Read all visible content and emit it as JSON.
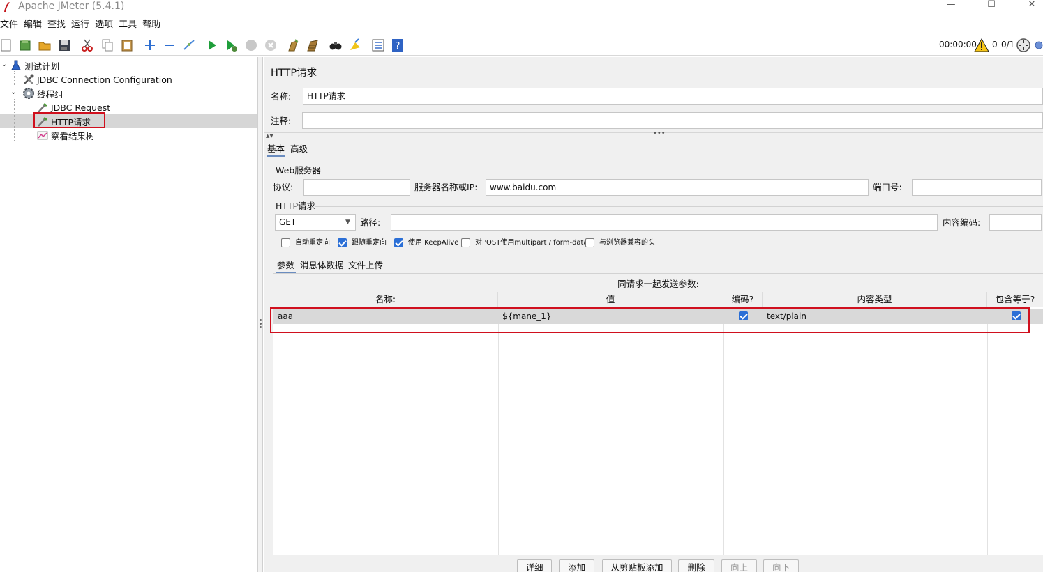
{
  "window": {
    "title": "Apache JMeter (5.4.1)",
    "minimize_glyph": "—",
    "maximize_glyph": "☐",
    "close_glyph": "✕"
  },
  "menu": [
    "文件",
    "编辑",
    "查找",
    "运行",
    "选项",
    "工具",
    "帮助"
  ],
  "toolbar": {
    "icons": [
      "new-icon",
      "templates-icon",
      "open-icon",
      "save-icon",
      "cut-icon",
      "copy-icon",
      "paste-icon",
      "expand-icon",
      "collapse-icon",
      "toggle-icon",
      "start-icon",
      "start-no-pause-icon",
      "stop-icon",
      "shutdown-icon",
      "clear-icon",
      "clear-all-icon",
      "search-icon",
      "reset-search-icon",
      "function-helper-icon",
      "help-icon"
    ],
    "timer": "00:00:00",
    "warning_count": "0",
    "thread_count": "0/1"
  },
  "tree": {
    "nodes": [
      {
        "label": "测试计划",
        "icon": "test-plan-icon"
      },
      {
        "label": "JDBC Connection Configuration",
        "icon": "config-tools-icon"
      },
      {
        "label": "线程组",
        "icon": "thread-group-gear-icon"
      },
      {
        "label": "JDBC Request",
        "icon": "sampler-pipette-icon"
      },
      {
        "label": "HTTP请求",
        "icon": "sampler-pipette-icon"
      },
      {
        "label": "察看结果树",
        "icon": "listener-graph-icon"
      }
    ],
    "selected_index": 4
  },
  "panel": {
    "heading": "HTTP请求",
    "name_label": "名称:",
    "name_value": "HTTP请求",
    "comment_label": "注释:",
    "comment_value": "",
    "tabs": [
      "基本",
      "高级"
    ],
    "web_server": {
      "group_title": "Web服务器",
      "protocol_label": "协议:",
      "protocol_value": "",
      "server_label": "服务器名称或IP:",
      "server_value": "www.baidu.com",
      "port_label": "端口号:",
      "port_value": ""
    },
    "http_request": {
      "group_title": "HTTP请求",
      "method": "GET",
      "path_label": "路径:",
      "path_value": "",
      "encoding_label": "内容编码:",
      "encoding_value": ""
    },
    "options": [
      {
        "label": "自动重定向",
        "checked": false
      },
      {
        "label": "跟随重定向",
        "checked": true
      },
      {
        "label": "使用 KeepAlive",
        "checked": true
      },
      {
        "label": "对POST使用multipart / form-data",
        "checked": false
      },
      {
        "label": "与浏览器兼容的头",
        "checked": false
      }
    ],
    "sub_tabs": [
      "参数",
      "消息体数据",
      "文件上传"
    ],
    "params_caption": "同请求一起发送参数:",
    "table": {
      "headers": [
        "名称:",
        "值",
        "编码?",
        "内容类型",
        "包含等于?"
      ],
      "rows": [
        {
          "name": "aaa",
          "value": "${mane_1}",
          "encode": true,
          "content_type": "text/plain",
          "include_equals": true
        }
      ]
    },
    "buttons": [
      {
        "label": "详细",
        "enabled": true
      },
      {
        "label": "添加",
        "enabled": true
      },
      {
        "label": "从剪贴板添加",
        "enabled": true
      },
      {
        "label": "删除",
        "enabled": true
      },
      {
        "label": "向上",
        "enabled": false
      },
      {
        "label": "向下",
        "enabled": false
      }
    ]
  },
  "colors": {
    "highlight_border": "#d0101e",
    "checkbox_checked": "#2b6fd6",
    "panel_background": "#f0f0f0",
    "selection_background": "#d6d6d6"
  }
}
